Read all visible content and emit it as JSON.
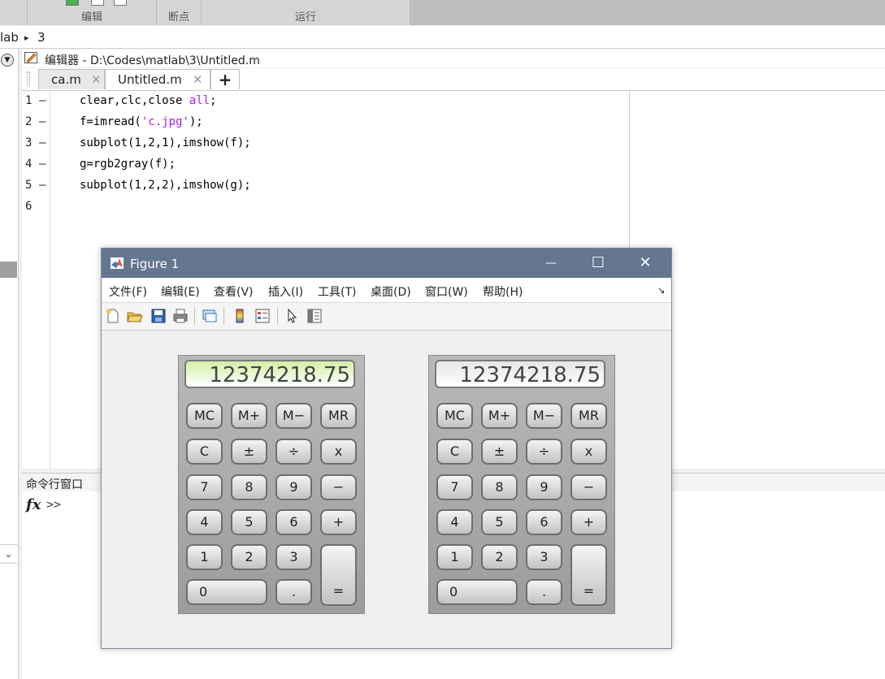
{
  "toolstrip": {
    "groups": [
      {
        "label": "编辑"
      },
      {
        "label": "断点"
      },
      {
        "label": "运行"
      }
    ]
  },
  "address": {
    "segments": [
      "lab",
      "3"
    ],
    "separator": "▸"
  },
  "editor": {
    "title": "编辑器 - D:\\Codes\\matlab\\3\\Untitled.m",
    "tabs": [
      {
        "label": "ca.m",
        "close": "✕"
      },
      {
        "label": "Untitled.m",
        "close": "✕"
      }
    ],
    "add_tab": "+",
    "line_numbers": [
      "1",
      "2",
      "3",
      "4",
      "5",
      "6"
    ],
    "dash": "—",
    "lines": [
      {
        "pre": "clear,clc,close ",
        "kw": "all",
        "post": ";"
      },
      {
        "pre": "f=imread(",
        "kw": "'c.jpg'",
        "post": ");"
      },
      {
        "pre": "subplot(1,2,1),imshow(f);",
        "kw": "",
        "post": ""
      },
      {
        "pre": "g=rgb2gray(f);",
        "kw": "",
        "post": ""
      },
      {
        "pre": "subplot(1,2,2),imshow(g);",
        "kw": "",
        "post": ""
      }
    ]
  },
  "command_window": {
    "title": "命令行窗口",
    "fx": "fx",
    "prompt": ">>"
  },
  "figure": {
    "title": "Figure 1",
    "controls": {
      "minimize": "—",
      "maximize": "☐",
      "close": "✕"
    },
    "menu": [
      "文件(F)",
      "编辑(E)",
      "查看(V)",
      "插入(I)",
      "工具(T)",
      "桌面(D)",
      "窗口(W)",
      "帮助(H)"
    ],
    "menu_arrow": "↘",
    "calculators": [
      {
        "display": "12374218.75",
        "display_color": "#d3f0a8"
      },
      {
        "display": "12374218.75",
        "display_color": "#e6e6e6"
      }
    ],
    "keys": {
      "mc": "MC",
      "mplus": "M+",
      "mminus": "M−",
      "mr": "MR",
      "c": "C",
      "pm": "±",
      "div": "÷",
      "mul": "x",
      "k7": "7",
      "k8": "8",
      "k9": "9",
      "minus": "−",
      "k4": "4",
      "k5": "5",
      "k6": "6",
      "plus": "+",
      "k1": "1",
      "k2": "2",
      "k3": "3",
      "k0": "0",
      "dot": ".",
      "eq": "="
    }
  },
  "colors": {
    "figure_titlebar": "#647690",
    "keyword": "#a020f0"
  }
}
